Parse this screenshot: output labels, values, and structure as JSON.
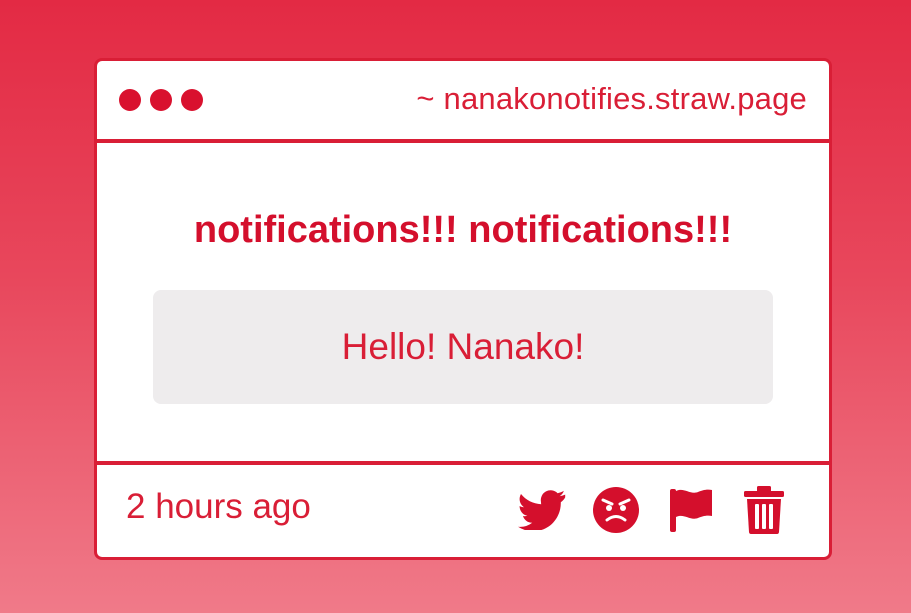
{
  "window": {
    "url": "~ nanakonotifies.straw.page"
  },
  "notification": {
    "headline": "notifications!!! notifications!!!",
    "message": "Hello! Nanako!",
    "timestamp": "2 hours ago"
  },
  "actions": [
    {
      "icon": "twitter-icon"
    },
    {
      "icon": "angry-face-icon"
    },
    {
      "icon": "flag-icon"
    },
    {
      "icon": "trash-icon"
    }
  ],
  "colors": {
    "accent": "#d91e36",
    "message_bg": "#eeeced",
    "background_top": "#e32a44",
    "background_bottom": "#f07a89"
  }
}
